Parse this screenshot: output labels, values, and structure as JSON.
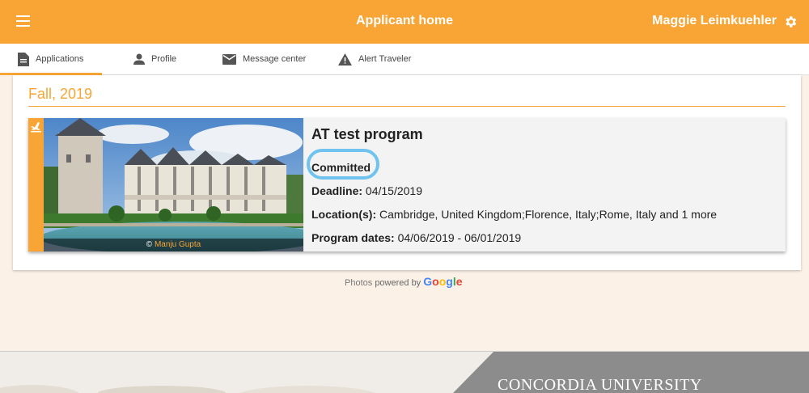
{
  "header": {
    "title": "Applicant home",
    "user_name": "Maggie Leimkuehler"
  },
  "tabs": [
    {
      "label": "Applications",
      "icon": "document-icon",
      "active": true
    },
    {
      "label": "Profile",
      "icon": "person-icon",
      "active": false
    },
    {
      "label": "Message center",
      "icon": "mail-icon",
      "active": false
    },
    {
      "label": "Alert Traveler",
      "icon": "warning-icon",
      "active": false
    }
  ],
  "term": "Fall, 2019",
  "application": {
    "program_name": "AT test program",
    "status": "Committed",
    "deadline_label": "Deadline:",
    "deadline": "04/15/2019",
    "location_label": "Location(s):",
    "locations": "Cambridge, United Kingdom;Florence, Italy;Rome, Italy and 1 more",
    "dates_label": "Program dates:",
    "dates": "04/06/2019 - 06/01/2019",
    "photo_credit_prefix": "©",
    "photo_credit_author": "Manju Gupta"
  },
  "attribution": {
    "photos": "Photos",
    "powered_by": "powered by",
    "google": "Google"
  },
  "footer": {
    "university": "CONCORDIA UNIVERSITY"
  },
  "colors": {
    "accent": "#f8a535",
    "status_highlight": "#6fc3ee"
  }
}
